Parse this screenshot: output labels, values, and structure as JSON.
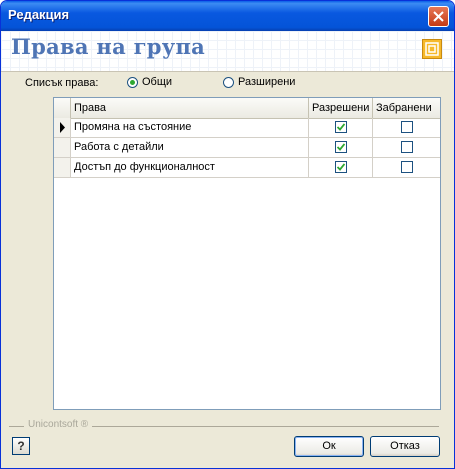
{
  "window": {
    "title": "Редакция"
  },
  "header": {
    "title": "Права на група"
  },
  "list_type": {
    "label": "Списък права:",
    "options": [
      "Общи",
      "Разширени"
    ],
    "selected": "Общи"
  },
  "grid": {
    "columns": [
      "Права",
      "Разрешени",
      "Забранени"
    ],
    "rows": [
      {
        "name": "Промяна на състояние",
        "allowed": true,
        "denied": false,
        "current": true
      },
      {
        "name": "Работа с детайли",
        "allowed": true,
        "denied": false,
        "current": false
      },
      {
        "name": "Достъп до функционалност",
        "allowed": true,
        "denied": false,
        "current": false
      }
    ]
  },
  "footer": {
    "brand": "Unicontsoft ®",
    "help": "?",
    "ok_label": "Ок",
    "cancel_label": "Отказ"
  },
  "colors": {
    "title_blue": "#4f75b5",
    "check_green": "#2ea832",
    "titlebar": "#0454d8"
  }
}
